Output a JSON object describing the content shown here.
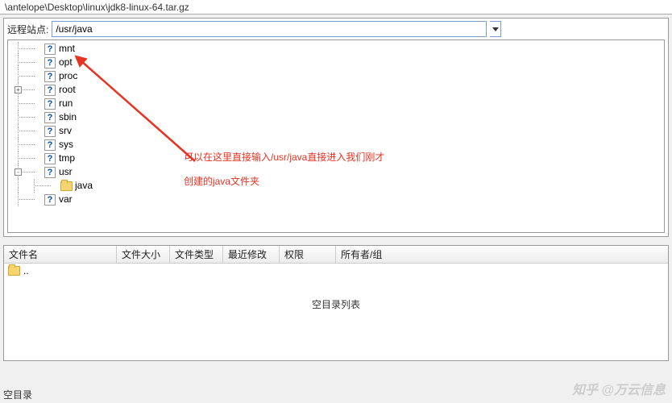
{
  "top_path": "\\antelope\\Desktop\\linux\\jdk8-linux-64.tar.gz",
  "remote": {
    "label": "远程站点:",
    "path_value": "/usr/java",
    "tree_nodes": [
      {
        "icon": "q",
        "label": "mnt"
      },
      {
        "icon": "q",
        "label": "opt"
      },
      {
        "icon": "q",
        "label": "proc"
      },
      {
        "icon": "q",
        "label": "root",
        "expander": "+"
      },
      {
        "icon": "q",
        "label": "run"
      },
      {
        "icon": "q",
        "label": "sbin"
      },
      {
        "icon": "q",
        "label": "srv"
      },
      {
        "icon": "q",
        "label": "sys"
      },
      {
        "icon": "q",
        "label": "tmp"
      },
      {
        "icon": "q",
        "label": "usr",
        "expander": "-"
      },
      {
        "icon": "folder",
        "label": "java",
        "indent": 2
      },
      {
        "icon": "q",
        "label": "var"
      }
    ]
  },
  "annotation": {
    "line1": "可以在这里直接输入/usr/java直接进入我们刚才",
    "line2": "创建的java文件夹"
  },
  "file_list": {
    "headers": {
      "name": "文件名",
      "size": "文件大小",
      "type": "文件类型",
      "date": "最近修改",
      "perm": "权限",
      "owner": "所有者/组"
    },
    "parent_row": "..",
    "empty_message": "空目录列表"
  },
  "status_bar": "空目录",
  "watermark": "知乎 @万云信息"
}
